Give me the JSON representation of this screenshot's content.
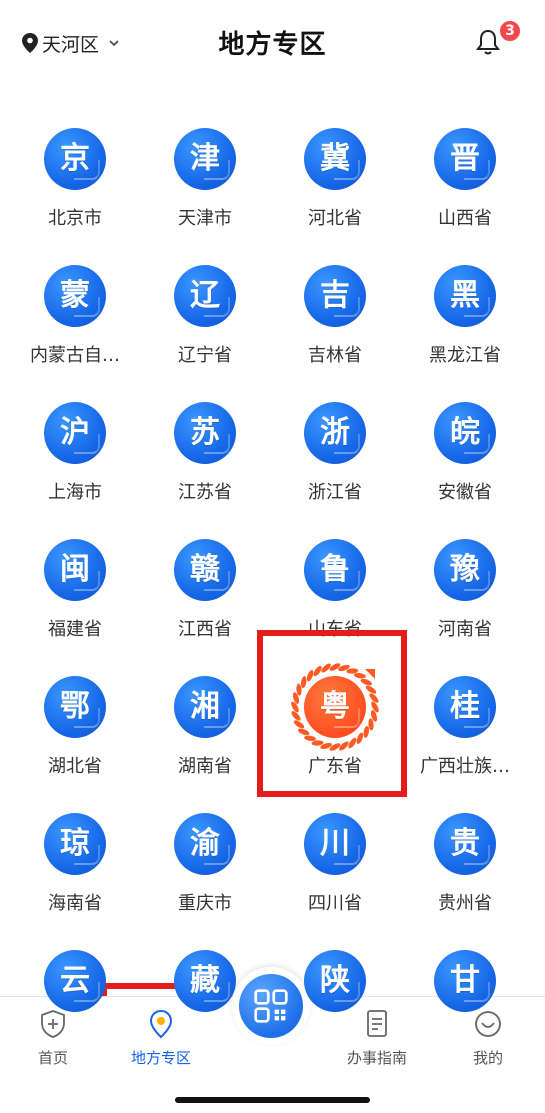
{
  "header": {
    "location": "天河区",
    "title": "地方专区",
    "notification_count": "3"
  },
  "provinces": [
    {
      "glyph": "京",
      "label": "北京市"
    },
    {
      "glyph": "津",
      "label": "天津市"
    },
    {
      "glyph": "冀",
      "label": "河北省"
    },
    {
      "glyph": "晋",
      "label": "山西省"
    },
    {
      "glyph": "蒙",
      "label": "内蒙古自…"
    },
    {
      "glyph": "辽",
      "label": "辽宁省"
    },
    {
      "glyph": "吉",
      "label": "吉林省"
    },
    {
      "glyph": "黑",
      "label": "黑龙江省"
    },
    {
      "glyph": "沪",
      "label": "上海市"
    },
    {
      "glyph": "苏",
      "label": "江苏省"
    },
    {
      "glyph": "浙",
      "label": "浙江省"
    },
    {
      "glyph": "皖",
      "label": "安徽省"
    },
    {
      "glyph": "闽",
      "label": "福建省"
    },
    {
      "glyph": "赣",
      "label": "江西省"
    },
    {
      "glyph": "鲁",
      "label": "山东省"
    },
    {
      "glyph": "豫",
      "label": "河南省"
    },
    {
      "glyph": "鄂",
      "label": "湖北省"
    },
    {
      "glyph": "湘",
      "label": "湖南省"
    },
    {
      "glyph": "粤",
      "label": "广东省",
      "highlighted": true
    },
    {
      "glyph": "桂",
      "label": "广西壮族…"
    },
    {
      "glyph": "琼",
      "label": "海南省"
    },
    {
      "glyph": "渝",
      "label": "重庆市"
    },
    {
      "glyph": "川",
      "label": "四川省"
    },
    {
      "glyph": "贵",
      "label": "贵州省"
    },
    {
      "glyph": "云",
      "label": ""
    },
    {
      "glyph": "藏",
      "label": ""
    },
    {
      "glyph": "陕",
      "label": ""
    },
    {
      "glyph": "甘",
      "label": ""
    }
  ],
  "bottom_nav": {
    "home": "首页",
    "local": "地方专区",
    "guide": "办事指南",
    "mine": "我的"
  },
  "colors": {
    "accent": "#1565e6",
    "highlight_box": "#e51c1c",
    "badge": "#f0484b",
    "guangdong_icon": "#ff4d1f"
  }
}
